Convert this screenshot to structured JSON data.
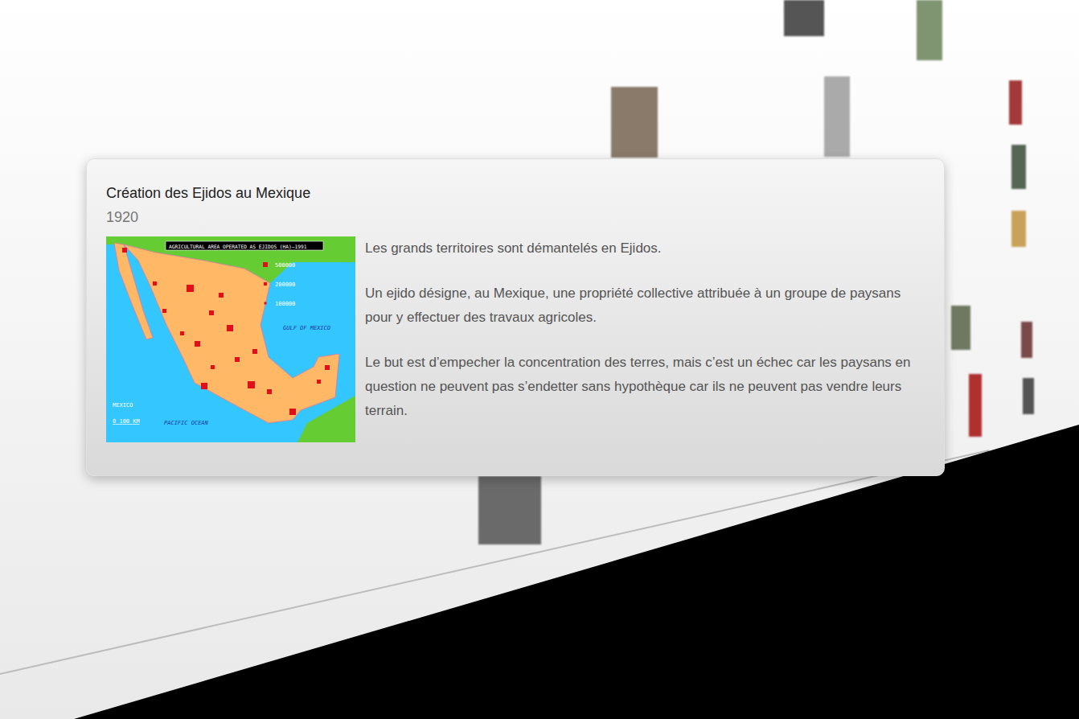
{
  "card": {
    "title": "Création des Ejidos au Mexique",
    "date": "1920",
    "paragraphs": [
      "Les grands territoires sont démantelés en Ejidos.",
      "Un ejido désigne, au Mexique, une propriété collective attribuée à un groupe de paysans pour y effectuer des travaux agricoles.",
      "Le but est d’empecher la concentration des terres, mais c’est un échec car les paysans en question ne peuvent pas s’endetter sans hypothèque car ils ne peuvent pas vendre leurs terrain."
    ]
  },
  "map": {
    "title": "AGRICULTURAL AREA OPERATED AS EJIDOS (HA)—1991",
    "legend": [
      "500000",
      "200000",
      "100000"
    ],
    "labels": [
      "GULF OF MEXICO",
      "MEXICO",
      "0 100 KM",
      "PACIFIC OCEAN"
    ]
  }
}
